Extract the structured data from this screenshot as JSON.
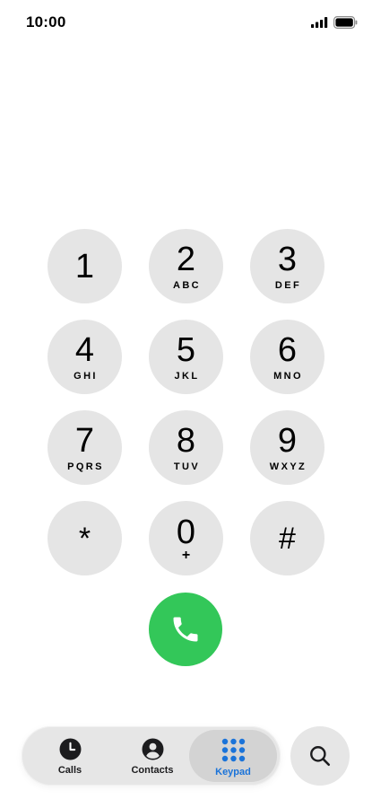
{
  "status_bar": {
    "time": "10:00"
  },
  "keypad": {
    "keys": [
      {
        "digit": "1",
        "letters": ""
      },
      {
        "digit": "2",
        "letters": "ABC"
      },
      {
        "digit": "3",
        "letters": "DEF"
      },
      {
        "digit": "4",
        "letters": "GHI"
      },
      {
        "digit": "5",
        "letters": "JKL"
      },
      {
        "digit": "6",
        "letters": "MNO"
      },
      {
        "digit": "7",
        "letters": "PQRS"
      },
      {
        "digit": "8",
        "letters": "TUV"
      },
      {
        "digit": "9",
        "letters": "WXYZ"
      },
      {
        "digit": "*",
        "letters": ""
      },
      {
        "digit": "0",
        "letters": "+"
      },
      {
        "digit": "#",
        "letters": ""
      }
    ]
  },
  "tab_bar": {
    "tabs": [
      {
        "label": "Calls",
        "icon": "clock-icon"
      },
      {
        "label": "Contacts",
        "icon": "person-circle-icon"
      },
      {
        "label": "Keypad",
        "icon": "keypad-grid-icon",
        "selected": true
      }
    ]
  },
  "colors": {
    "key_background": "#e5e5e5",
    "call_green": "#33c759",
    "accent_blue": "#1a73d9"
  }
}
